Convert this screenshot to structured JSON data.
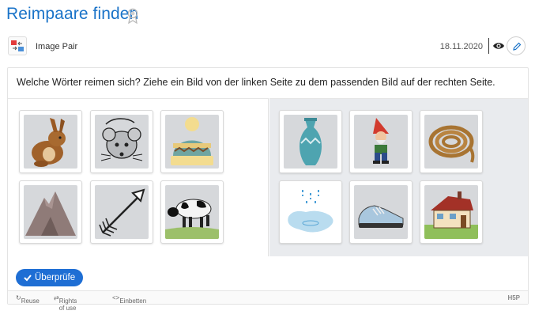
{
  "header": {
    "title": "Reimpaare finden"
  },
  "meta": {
    "content_type": "Image Pair",
    "date": "18.11.2020"
  },
  "task": {
    "question": "Welche Wörter reimen sich? Ziehe ein Bild von der linken Seite zu dem passenden Bild auf der rechten Seite.",
    "left_images": [
      "hare",
      "mouse",
      "beanie",
      "mountain",
      "arrow",
      "cow"
    ],
    "right_images": [
      "vase",
      "garden-gnome",
      "rope",
      "puddle",
      "shoe",
      "house"
    ],
    "check_label": "Überprüfe"
  },
  "footer": {
    "reuse": "Reuse",
    "rights": "Rights of use",
    "embed": "Einbetten",
    "logo": "H5P"
  },
  "colors": {
    "accent": "#1a73c8",
    "button": "#1e6ed4",
    "right_pane_bg": "#e9ebee"
  }
}
